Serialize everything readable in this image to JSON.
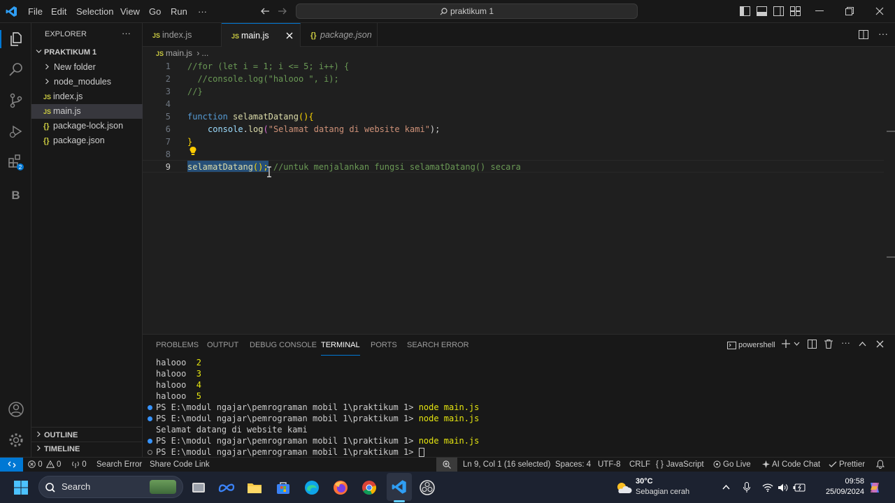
{
  "menu": [
    "File",
    "Edit",
    "Selection",
    "View",
    "Go",
    "Run",
    "···"
  ],
  "search": {
    "text": "praktikum 1"
  },
  "sidebar": {
    "title": "EXPLORER",
    "more": "···",
    "project": "PRAKTIKUM 1",
    "items": [
      {
        "label": "New folder",
        "icon": ""
      },
      {
        "label": "node_modules",
        "icon": ""
      },
      {
        "label": "index.js",
        "icon": "JS"
      },
      {
        "label": "main.js",
        "icon": "JS"
      },
      {
        "label": "package-lock.json",
        "icon": "{}"
      },
      {
        "label": "package.json",
        "icon": "{}"
      }
    ],
    "outline": "OUTLINE",
    "timeline": "TIMELINE"
  },
  "tabs": [
    {
      "icon": "JS",
      "label": "index.js"
    },
    {
      "icon": "JS",
      "label": "main.js"
    },
    {
      "icon": "{}",
      "label": "package.json"
    }
  ],
  "breadcrumb": {
    "icon": "JS",
    "file": "main.js",
    "sep": "›",
    "rest": "..."
  },
  "editor": {
    "lines": [
      "1",
      "2",
      "3",
      "4",
      "5",
      "6",
      "7",
      "8",
      "9"
    ],
    "l1": "//for (let i = 1; i <= 5; i++) {",
    "l2": "  //console.log(\"halooo \", i);",
    "l3": "//}",
    "l5_kw": "function",
    "l5_fn": "selamatDatang",
    "l5_p": "(){",
    "l6_obj": "console",
    "l6_dot": ".",
    "l6_fn": "log",
    "l6_p1": "(",
    "l6_str": "\"Selamat datang di website kami\"",
    "l6_p2": ");",
    "l7": "}",
    "l9_fn": "selamatDatang",
    "l9_p": "();",
    "l9_cm": "//untuk menjalankan fungsi selamatDatang() secara"
  },
  "panel": {
    "tabs": [
      "PROBLEMS",
      "OUTPUT",
      "DEBUG CONSOLE",
      "TERMINAL",
      "PORTS",
      "SEARCH ERROR"
    ],
    "shell": "powershell",
    "lines": [
      {
        "a": "halooo  ",
        "b": "2"
      },
      {
        "a": "halooo  ",
        "b": "3"
      },
      {
        "a": "halooo  ",
        "b": "4"
      },
      {
        "a": "halooo  ",
        "b": "5"
      },
      {
        "a": "PS E:\\modul ngajar\\pemrograman mobil 1\\praktikum 1> ",
        "b": "node main.js"
      },
      {
        "a": "PS E:\\modul ngajar\\pemrograman mobil 1\\praktikum 1> ",
        "b": "node main.js"
      },
      {
        "a": "Selamat datang di website kami",
        "b": ""
      },
      {
        "a": "PS E:\\modul ngajar\\pemrograman mobil 1\\praktikum 1> ",
        "b": "node main.js"
      },
      {
        "a": "PS E:\\modul ngajar\\pemrograman mobil 1\\praktikum 1> ",
        "b": ""
      }
    ]
  },
  "status": {
    "errors": "0",
    "warnings": "0",
    "ports": "0",
    "search_error": "Search Error",
    "share": "Share Code Link",
    "position": "Ln 9, Col 1 (16 selected)",
    "spaces": "Spaces: 4",
    "encoding": "UTF-8",
    "eol": "CRLF",
    "lang_icon": "{ }",
    "language": "JavaScript",
    "golive": "Go Live",
    "ai": "AI Code Chat",
    "prettier": "Prettier"
  },
  "taskbar": {
    "search": "Search",
    "temp": "30°C",
    "weather": "Sebagian cerah",
    "time": "09:58",
    "date": "25/09/2024"
  },
  "colors": {
    "accent": "#0078d4",
    "activeTabTop": "#0078d4",
    "selection": "#264f78"
  }
}
